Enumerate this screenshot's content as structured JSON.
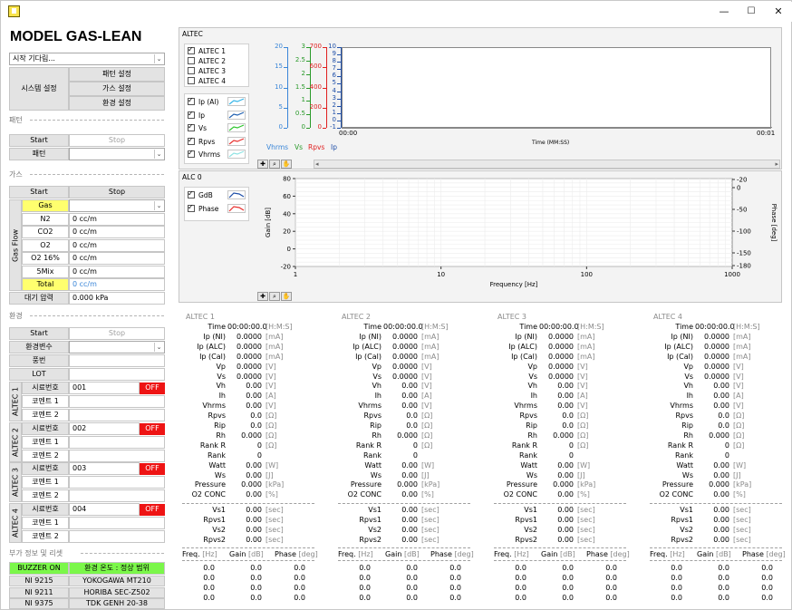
{
  "window": {
    "min": "—",
    "max": "☐",
    "close": "✕"
  },
  "app_title": "MODEL GAS-LEAN",
  "start_diagram": "시작 기다림...",
  "system_settings": {
    "label": "시스템 설정",
    "pattern_btn": "패턴 설정",
    "gas_btn": "가스 설정",
    "env_btn": "환경 설정"
  },
  "pattern": {
    "section": "패턴",
    "start": "Start",
    "stop": "Stop",
    "label": "패턴",
    "value": ""
  },
  "gas": {
    "section": "가스",
    "start": "Start",
    "stop": "Stop",
    "group_label": "Gas Flow",
    "gas_label": "Gas",
    "gas_value": "",
    "rows": [
      {
        "name": "N2",
        "value": "0 cc/m"
      },
      {
        "name": "CO2",
        "value": "0 cc/m"
      },
      {
        "name": "O2",
        "value": "0 cc/m"
      },
      {
        "name": "O2 16%",
        "value": "0 cc/m"
      },
      {
        "name": "5Mix",
        "value": "0 cc/m"
      }
    ],
    "total_label": "Total",
    "total_value": "0 cc/m",
    "atm_label": "대기 압력",
    "atm_value": "0.000 kPa"
  },
  "env": {
    "section": "환경",
    "start": "Start",
    "stop": "Stop",
    "var_label": "환경변수",
    "var_value": "",
    "pungbun": "풍번",
    "lot": "LOT",
    "altecs": [
      {
        "label": "ALTEC 1",
        "sample_label": "시료번호",
        "sample": "001",
        "status": "OFF",
        "c1": "코멘트 1",
        "c2": "코멘트 2"
      },
      {
        "label": "ALTEC 2",
        "sample_label": "시료번호",
        "sample": "002",
        "status": "OFF",
        "c1": "코멘트 1",
        "c2": "코멘트 2"
      },
      {
        "label": "ALTEC 3",
        "sample_label": "시료번호",
        "sample": "003",
        "status": "OFF",
        "c1": "코멘트 1",
        "c2": "코멘트 2"
      },
      {
        "label": "ALTEC 4",
        "sample_label": "시료번호",
        "sample": "004",
        "status": "OFF",
        "c1": "코멘트 1",
        "c2": "코멘트 2"
      }
    ]
  },
  "extra": {
    "section": "부가 정보 및 리셋",
    "buzzer": "BUZZER ON",
    "env_temp": "환경 온도 : 정상 범위",
    "devices": [
      {
        "port": "NI 9215",
        "device": "YOKOGAWA MT210"
      },
      {
        "port": "NI 9211",
        "device": "HORIBA SEC-Z502"
      },
      {
        "port": "NI 9375",
        "device": "TDK GENH 20-38"
      }
    ]
  },
  "altec_chart": {
    "panel_title": "ALTEC",
    "channels": [
      "ALTEC 1",
      "ALTEC 2",
      "ALTEC 3",
      "ALTEC 4"
    ],
    "channels_checked": [
      true,
      false,
      false,
      false
    ],
    "plots": [
      {
        "name": "Ip (Al)",
        "color": "#35b5e8"
      },
      {
        "name": "Ip",
        "color": "#1f5fb0"
      },
      {
        "name": "Vs",
        "color": "#2ec52e"
      },
      {
        "name": "Rpvs",
        "color": "#e8312f"
      },
      {
        "name": "Vhrms",
        "color": "#8fe3e3"
      }
    ],
    "axis_labels": [
      {
        "text": "Vhrms",
        "color": "#3a86d8"
      },
      {
        "text": "Vs",
        "color": "#2a9a2a"
      },
      {
        "text": "Rpvs",
        "color": "#e02020"
      },
      {
        "text": "Ip",
        "color": "#1f4fa8"
      }
    ],
    "axis_a_ticks": [
      "20",
      "15",
      "10",
      "5",
      "0"
    ],
    "axis_b_ticks": [
      "3",
      "2.5",
      "2",
      "1.5",
      "1",
      "0.5",
      "0"
    ],
    "axis_c_ticks": [
      "700",
      "600",
      "400",
      "200",
      "0"
    ],
    "axis_d_ticks": [
      "10",
      "9",
      "8",
      "7",
      "6",
      "5",
      "4",
      "3",
      "2",
      "1",
      "0",
      "-1"
    ],
    "x_start": "00:00",
    "x_end": "00:01",
    "xlabel": "Time (MM:SS)"
  },
  "chart_data": {
    "type": "line",
    "title": "ALC 0",
    "xlabel": "Frequency [Hz]",
    "ylabel": "Gain [dB]",
    "y2label": "Phase [deg]",
    "xscale": "log",
    "xlim": [
      1,
      1000
    ],
    "ylim": [
      -20,
      80
    ],
    "y2lim": [
      -180,
      -20
    ],
    "x_ticks": [
      "1",
      "10",
      "100",
      "1000"
    ],
    "y_ticks": [
      "80",
      "60",
      "40",
      "20",
      "0",
      "-20"
    ],
    "y2_ticks": [
      "-20",
      "0",
      "-50",
      "-100",
      "-150",
      "-180"
    ],
    "series": [
      {
        "name": "GdB",
        "color": "#1f4fa8",
        "values": []
      },
      {
        "name": "Phase",
        "color": "#e8312f",
        "values": []
      }
    ],
    "grid": true
  },
  "readouts": {
    "labels": [
      "Time",
      "Ip (NI)",
      "Ip (ALC)",
      "Ip (Cal)",
      "Vp",
      "Vs",
      "Vh",
      "Ih",
      "Vhrms",
      "Rpvs",
      "Rip",
      "Rh",
      "Rank R",
      "Rank",
      "Watt",
      "Ws",
      "Pressure",
      "O2 CONC"
    ],
    "units": [
      "[H:M:S]",
      "[mA]",
      "[mA]",
      "[mA]",
      "[V]",
      "[V]",
      "[V]",
      "[A]",
      "[V]",
      "[Ω]",
      "[Ω]",
      "[Ω]",
      "[Ω]",
      "",
      "[W]",
      "[J]",
      "[kPa]",
      "[%]"
    ],
    "values": [
      "00:00:00.0",
      "0.0000",
      "0.0000",
      "0.0000",
      "0.0000",
      "0.0000",
      "0.00",
      "0.00",
      "0.00",
      "0.0",
      "0.0",
      "0.000",
      "0",
      "0",
      "0.00",
      "0.00",
      "0.000",
      "0.00"
    ],
    "time_labels": [
      "Vs1",
      "Rpvs1",
      "Vs2",
      "Rpvs2"
    ],
    "time_unit": "[sec]",
    "time_value": "0.00",
    "freq_header": [
      {
        "name": "Freq.",
        "unit": "[Hz]"
      },
      {
        "name": "Gain",
        "unit": "[dB]"
      },
      {
        "name": "Phase",
        "unit": "[deg]"
      }
    ],
    "freq_rows": [
      [
        "0.0",
        "0.0",
        "0.0"
      ],
      [
        "0.0",
        "0.0",
        "0.0"
      ],
      [
        "0.0",
        "0.0",
        "0.0"
      ],
      [
        "0.0",
        "0.0",
        "0.0"
      ]
    ],
    "columns": [
      {
        "title": "ALTEC 1"
      },
      {
        "title": "ALTEC 2"
      },
      {
        "title": "ALTEC 3"
      },
      {
        "title": "ALTEC 4"
      }
    ]
  }
}
